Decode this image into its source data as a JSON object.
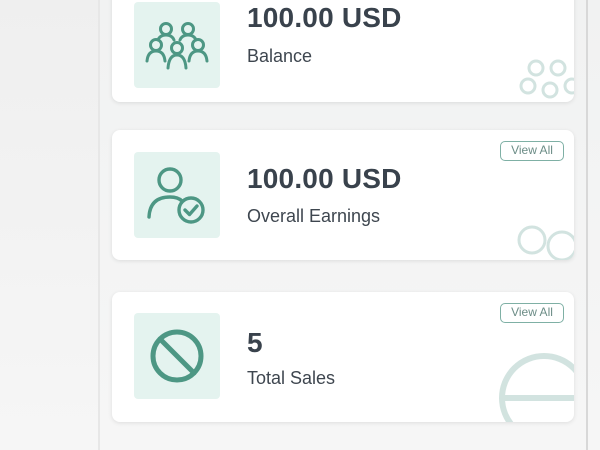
{
  "colors": {
    "accent": "#4d9784",
    "icon_bg": "#e4f3ef",
    "view_all_border": "#7fb0a5",
    "text_dark": "#39424c",
    "card_bg": "#ffffff"
  },
  "cards": [
    {
      "value": "100.00 USD",
      "label": "Balance",
      "icon": "users-group-icon"
    },
    {
      "value": "100.00 USD",
      "label": "Overall Earnings",
      "icon": "user-check-icon",
      "action_label": "View All"
    },
    {
      "value": "5",
      "label": "Total Sales",
      "icon": "ban-icon",
      "action_label": "View All"
    }
  ]
}
